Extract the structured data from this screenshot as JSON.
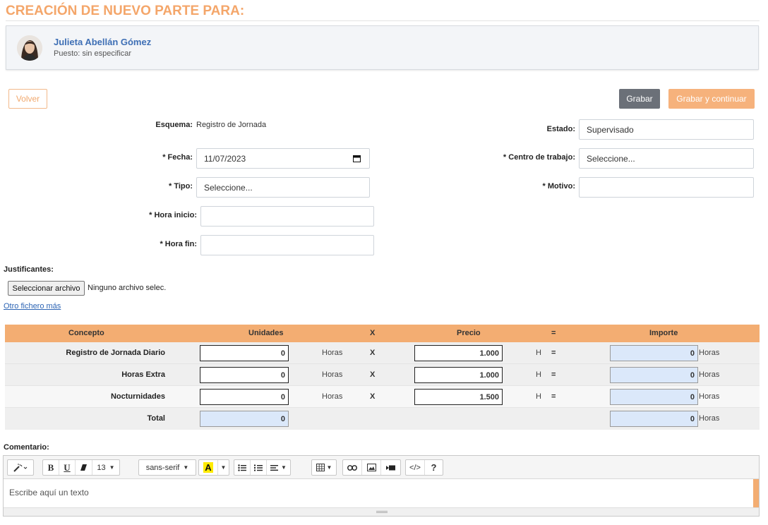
{
  "header": {
    "title": "CREACIÓN DE NUEVO PARTE PARA:"
  },
  "employee": {
    "name": "Julieta Abellán Gómez",
    "puesto": "Puesto: sin especificar"
  },
  "actions": {
    "volver": "Volver",
    "grabar": "Grabar",
    "grabar_continuar": "Grabar y continuar"
  },
  "form": {
    "esquema_label": "Esquema:",
    "esquema_value": "Registro de Jornada",
    "fecha_label": "* Fecha:",
    "fecha_value": "11/07/2023",
    "tipo_label": "* Tipo:",
    "tipo_value": "Seleccione...",
    "hora_inicio_label": "* Hora inicio:",
    "hora_inicio_value": "",
    "hora_fin_label": "* Hora fin:",
    "hora_fin_value": "",
    "estado_label": "Estado:",
    "estado_value": "Supervisado",
    "centro_label": "* Centro de trabajo:",
    "centro_value": "Seleccione...",
    "motivo_label": "* Motivo:",
    "motivo_value": ""
  },
  "justificantes": {
    "label": "Justificantes:",
    "file_button": "Seleccionar archivo",
    "file_status": "Ninguno archivo selec.",
    "otro_link": "Otro fichero más"
  },
  "table": {
    "headers": {
      "concepto": "Concepto",
      "unidades": "Unidades",
      "x": "X",
      "precio": "Precio",
      "eq": "=",
      "importe": "Importe"
    },
    "rows": [
      {
        "concepto": "Registro de Jornada Diario",
        "unidades": "0",
        "unit": "Horas",
        "x": "X",
        "precio": "1.000",
        "h": "H",
        "eq": "=",
        "importe": "0",
        "importe_unit": "Horas"
      },
      {
        "concepto": "Horas Extra",
        "unidades": "0",
        "unit": "Horas",
        "x": "X",
        "precio": "1.000",
        "h": "H",
        "eq": "=",
        "importe": "0",
        "importe_unit": "Horas"
      },
      {
        "concepto": "Nocturnidades",
        "unidades": "0",
        "unit": "Horas",
        "x": "X",
        "precio": "1.500",
        "h": "H",
        "eq": "=",
        "importe": "0",
        "importe_unit": "Horas"
      }
    ],
    "total": {
      "label": "Total",
      "unidades": "0",
      "importe": "0",
      "importe_unit": "Horas"
    }
  },
  "comentario": {
    "label": "Comentario:",
    "placeholder": "Escribe aquí un texto",
    "toolbar": {
      "font_size": "13",
      "font_family": "sans-serif",
      "bold": "B",
      "underline": "U",
      "color_letter": "A",
      "help": "?",
      "code": "</>"
    }
  }
}
